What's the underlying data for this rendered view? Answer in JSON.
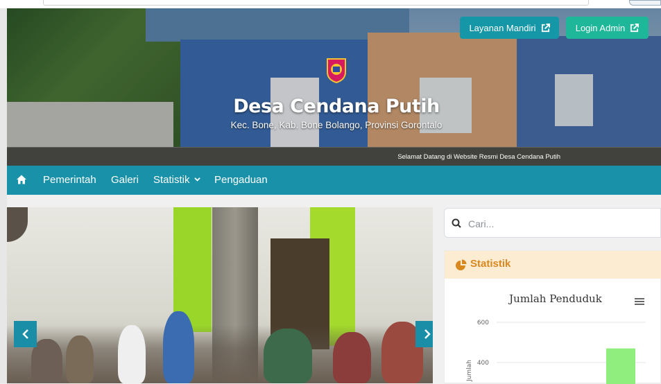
{
  "header": {
    "title": "Desa Cendana Putih",
    "subtitle": "Kec. Bone, Kab. Bone Bolango, Provinsi Gorontalo",
    "welcome": "Selamat Datang di Website Resmi Desa Cendana Putih",
    "buttons": {
      "layanan": "Layanan Mandiri",
      "login": "Login Admin"
    }
  },
  "nav": {
    "items": [
      "Pemerintah",
      "Galeri",
      "Statistik",
      "Pengaduan"
    ]
  },
  "search": {
    "placeholder": "Cari..."
  },
  "sidebar": {
    "stat_title": "Statistik"
  },
  "colors": {
    "nav": "#1891a9",
    "btn_layanan": "#1597a7",
    "btn_login": "#1fb79a",
    "stat_header_bg": "#fbecd2",
    "stat_header_text": "#d9871f",
    "bar": "#90ee7e"
  },
  "chart_data": {
    "type": "bar",
    "title": "Jumlah Penduduk",
    "ylabel": "Jumlah",
    "yticks": [
      400,
      600
    ],
    "ylim": [
      0,
      600
    ],
    "grid": true,
    "series": [
      {
        "values": [
          470
        ]
      }
    ]
  }
}
